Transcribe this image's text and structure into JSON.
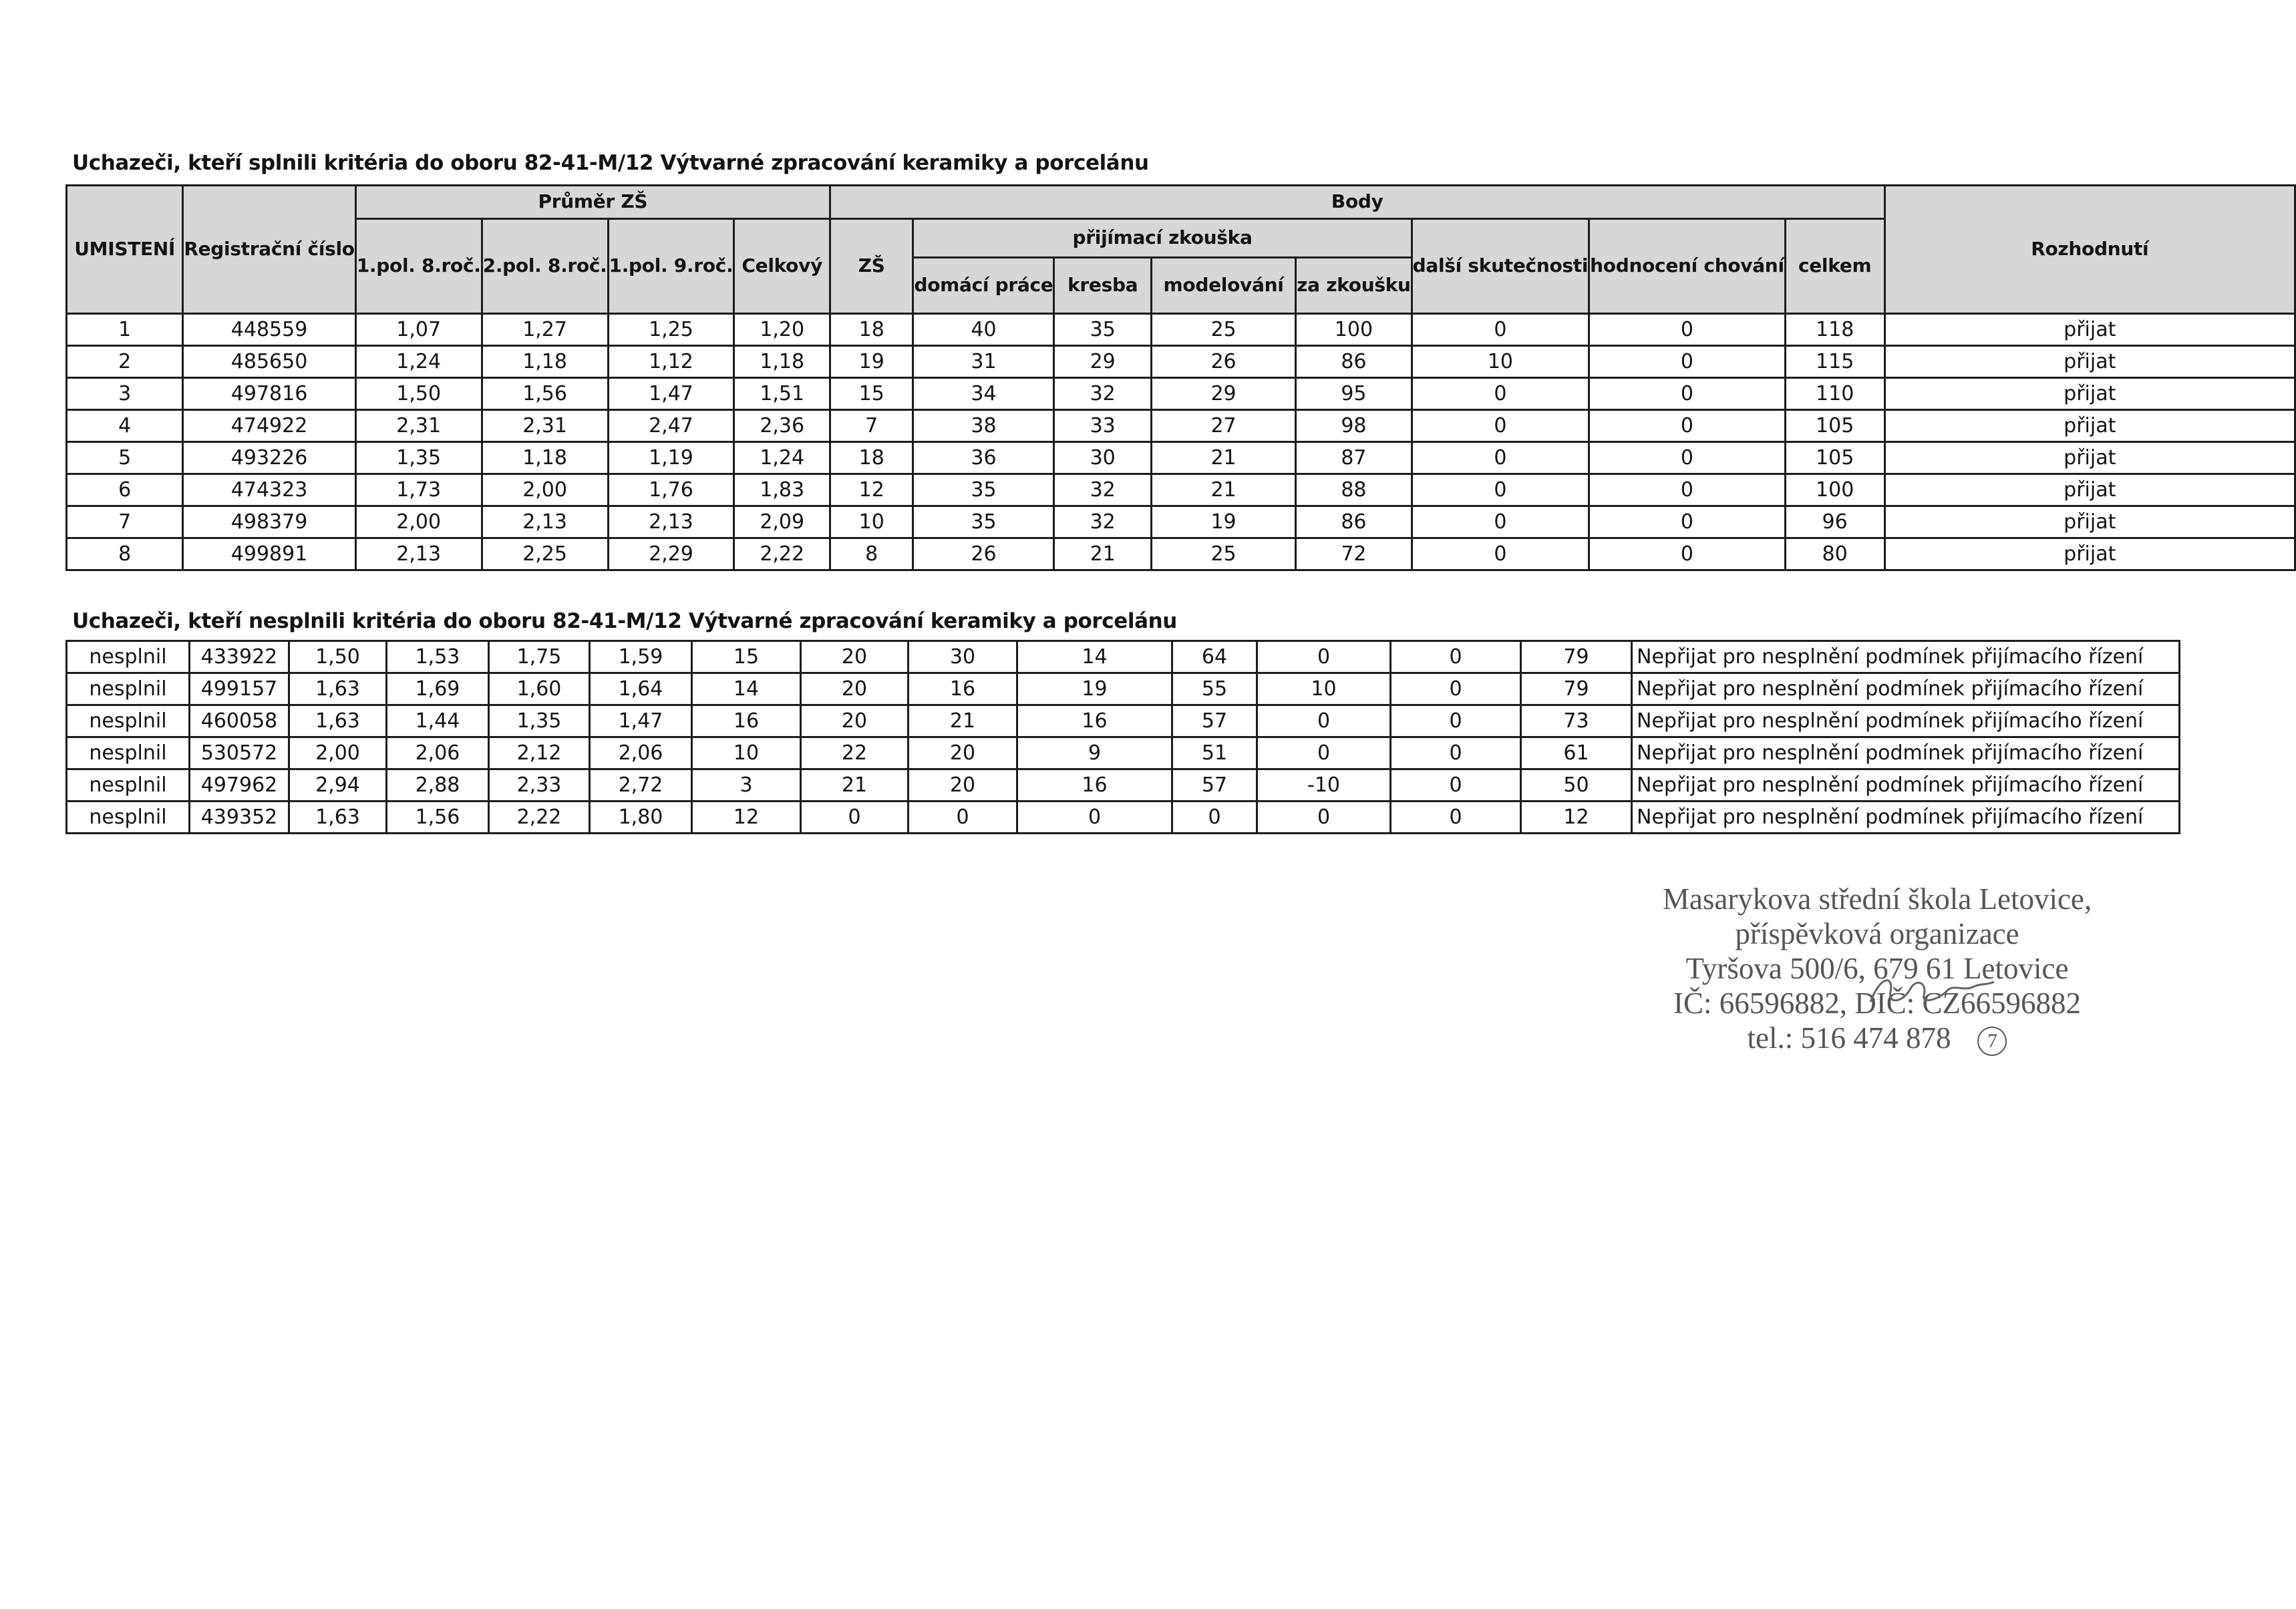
{
  "section1": {
    "title": "Uchazeči, kteří splnili kritéria do oboru 82-41-M/12 Výtvarné zpracování keramiky a porcelánu",
    "headers": {
      "umisteni": "UMISTENÍ",
      "registracni": "Registrační číslo",
      "prumer_zs": "Průměr ZŠ",
      "pol1_8": "1.pol. 8.roč.",
      "pol2_8": "2.pol. 8.roč.",
      "pol1_9": "1.pol. 9.roč.",
      "celkovy": "Celkový",
      "body": "Body",
      "zs": "ZŠ",
      "prijimaci_zkouska": "přijímací zkouška",
      "domaci_prace": "domácí práce",
      "kresba": "kresba",
      "modelovani": "modelování",
      "za_zkousku": "za zkoušku",
      "dalsi_skutecnosti": "další skutečnosti",
      "hodnoceni_chovani": "hodnocení chování",
      "celkem": "celkem",
      "rozhodnuti": "Rozhodnutí"
    },
    "rows": [
      [
        "1",
        "448559",
        "1,07",
        "1,27",
        "1,25",
        "1,20",
        "18",
        "40",
        "35",
        "25",
        "100",
        "0",
        "0",
        "118",
        "přijat"
      ],
      [
        "2",
        "485650",
        "1,24",
        "1,18",
        "1,12",
        "1,18",
        "19",
        "31",
        "29",
        "26",
        "86",
        "10",
        "0",
        "115",
        "přijat"
      ],
      [
        "3",
        "497816",
        "1,50",
        "1,56",
        "1,47",
        "1,51",
        "15",
        "34",
        "32",
        "29",
        "95",
        "0",
        "0",
        "110",
        "přijat"
      ],
      [
        "4",
        "474922",
        "2,31",
        "2,31",
        "2,47",
        "2,36",
        "7",
        "38",
        "33",
        "27",
        "98",
        "0",
        "0",
        "105",
        "přijat"
      ],
      [
        "5",
        "493226",
        "1,35",
        "1,18",
        "1,19",
        "1,24",
        "18",
        "36",
        "30",
        "21",
        "87",
        "0",
        "0",
        "105",
        "přijat"
      ],
      [
        "6",
        "474323",
        "1,73",
        "2,00",
        "1,76",
        "1,83",
        "12",
        "35",
        "32",
        "21",
        "88",
        "0",
        "0",
        "100",
        "přijat"
      ],
      [
        "7",
        "498379",
        "2,00",
        "2,13",
        "2,13",
        "2,09",
        "10",
        "35",
        "32",
        "19",
        "86",
        "0",
        "0",
        "96",
        "přijat"
      ],
      [
        "8",
        "499891",
        "2,13",
        "2,25",
        "2,29",
        "2,22",
        "8",
        "26",
        "21",
        "25",
        "72",
        "0",
        "0",
        "80",
        "přijat"
      ]
    ]
  },
  "section2": {
    "title": "Uchazeči, kteří nesplnili kritéria do oboru 82-41-M/12 Výtvarné zpracování keramiky a porcelánu",
    "rows": [
      [
        "nesplnil",
        "433922",
        "1,50",
        "1,53",
        "1,75",
        "1,59",
        "15",
        "20",
        "30",
        "14",
        "64",
        "0",
        "0",
        "79",
        "Nepřijat pro nesplnění podmínek přijímacího řízení"
      ],
      [
        "nesplnil",
        "499157",
        "1,63",
        "1,69",
        "1,60",
        "1,64",
        "14",
        "20",
        "16",
        "19",
        "55",
        "10",
        "0",
        "79",
        "Nepřijat pro nesplnění podmínek přijímacího řízení"
      ],
      [
        "nesplnil",
        "460058",
        "1,63",
        "1,44",
        "1,35",
        "1,47",
        "16",
        "20",
        "21",
        "16",
        "57",
        "0",
        "0",
        "73",
        "Nepřijat pro nesplnění podmínek přijímacího řízení"
      ],
      [
        "nesplnil",
        "530572",
        "2,00",
        "2,06",
        "2,12",
        "2,06",
        "10",
        "22",
        "20",
        "9",
        "51",
        "0",
        "0",
        "61",
        "Nepřijat pro nesplnění podmínek přijímacího řízení"
      ],
      [
        "nesplnil",
        "497962",
        "2,94",
        "2,88",
        "2,33",
        "2,72",
        "3",
        "21",
        "20",
        "16",
        "57",
        "-10",
        "0",
        "50",
        "Nepřijat pro nesplnění podmínek přijímacího řízení"
      ],
      [
        "nesplnil",
        "439352",
        "1,63",
        "1,56",
        "2,22",
        "1,80",
        "12",
        "0",
        "0",
        "0",
        "0",
        "0",
        "0",
        "12",
        "Nepřijat pro nesplnění podmínek přijímacího řízení"
      ]
    ]
  },
  "stamp": {
    "line1": "Masarykova střední škola Letovice,",
    "line2": "příspěvková organizace",
    "line3": "Tyršova 500/6, 679 61 Letovice",
    "line4": "IČ: 66596882, DIČ: CZ66596882",
    "line5": "tel.: 516 474 878",
    "mark": "7"
  }
}
